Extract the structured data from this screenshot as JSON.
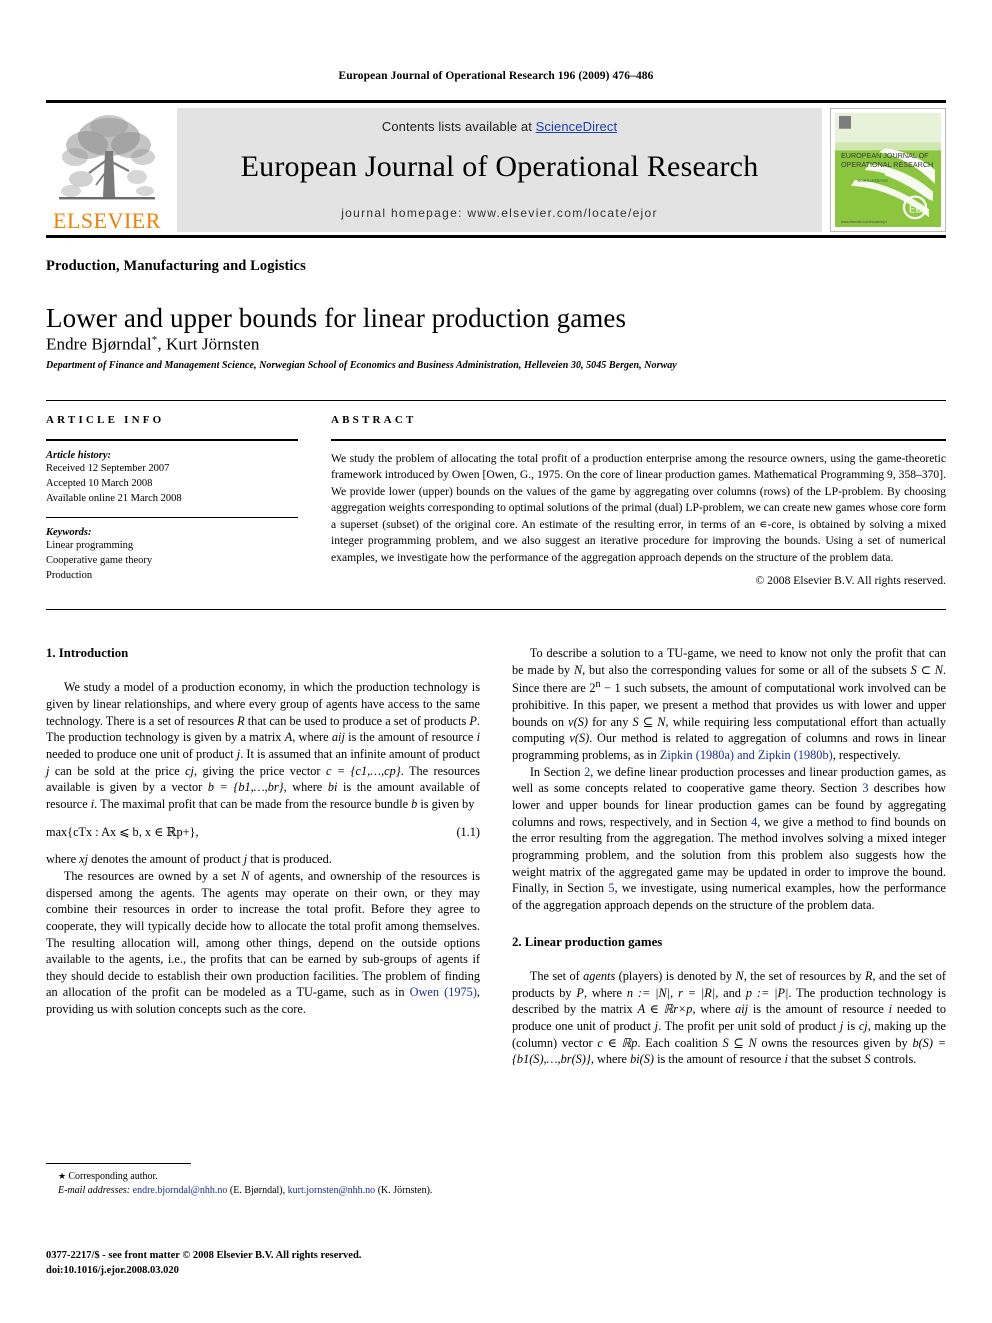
{
  "running_head": "European Journal of Operational Research 196 (2009) 476–486",
  "masthead": {
    "contents_prefix": "Contents lists available at ",
    "contents_link": "ScienceDirect",
    "journal_title": "European Journal of Operational Research",
    "homepage": "journal homepage: www.elsevier.com/locate/ejor",
    "publisher_wordmark": "ELSEVIER",
    "cover_line1": "EUROPEAN JOURNAL OF",
    "cover_line2": "OPERATIONAL RESEARCH",
    "cover_line3": "ScienceDirect",
    "cover_footer": "www.elsevier.com/locate/ejor",
    "colors": {
      "link": "#1a3fae",
      "elsevier_orange": "#f08000",
      "panel_gray": "#e3e3e3",
      "cover_green": "#8cc63f"
    }
  },
  "article": {
    "section_category": "Production, Manufacturing and Logistics",
    "title": "Lower and upper bounds for linear production games",
    "authors": "Endre Bjørndal",
    "corresponding_marker": "*",
    "authors_rest": ", Kurt Jörnsten",
    "affiliation": "Department of Finance and Management Science, Norwegian School of Economics and Business Administration, Helleveien 30, 5045 Bergen, Norway"
  },
  "info": {
    "heading": "ARTICLE INFO",
    "history_label": "Article history:",
    "history": [
      "Received 12 September 2007",
      "Accepted 10 March 2008",
      "Available online 21 March 2008"
    ],
    "keywords_label": "Keywords:",
    "keywords": [
      "Linear programming",
      "Cooperative game theory",
      "Production"
    ]
  },
  "abstract": {
    "heading": "ABSTRACT",
    "text": "We study the problem of allocating the total profit of a production enterprise among the resource owners, using the game-theoretic framework introduced by Owen [Owen, G., 1975. On the core of linear production games. Mathematical Programming 9, 358–370]. We provide lower (upper) bounds on the values of the game by aggregating over columns (rows) of the LP-problem. By choosing aggregation weights corresponding to optimal solutions of the primal (dual) LP-problem, we can create new games whose core form a superset (subset) of the original core. An estimate of the resulting error, in terms of an ∊-core, is obtained by solving a mixed integer programming problem, and we also suggest an iterative procedure for improving the bounds. Using a set of numerical examples, we investigate how the performance of the aggregation approach depends on the structure of the problem data.",
    "copyright": "© 2008 Elsevier B.V. All rights reserved."
  },
  "body": {
    "intro_heading": "1. Introduction",
    "intro_p1_a": "We study a model of a production economy, in which the production technology is given by linear relationships, and where every group of agents have access to the same technology. There is a set of resources ",
    "intro_p1_R": "R",
    "intro_p1_b": " that can be used to produce a set of products ",
    "intro_p1_P": "P",
    "intro_p1_c": ". The production technology is given by a matrix ",
    "intro_p1_A": "A",
    "intro_p1_d": ", where ",
    "intro_p1_aij": "aij",
    "intro_p1_e": " is the amount of resource ",
    "intro_p1_i": "i",
    "intro_p1_f": " needed to produce one unit of product ",
    "intro_p1_j": "j",
    "intro_p1_g": ". It is assumed that an infinite amount of product ",
    "intro_p1_j2": "j",
    "intro_p1_h": " can be sold at the price ",
    "intro_p1_cj": "cj",
    "intro_p1_i2": ", giving the price vector ",
    "intro_p1_cvec": "c = {c1,…,cp}",
    "intro_p1_j3": ". The resources available is given by a vector ",
    "intro_p1_bvec": "b = {b1,…,br}",
    "intro_p1_k": ", where ",
    "intro_p1_bi": "bi",
    "intro_p1_l": " is the amount available of resource ",
    "intro_p1_i3": "i",
    "intro_p1_m": ". The maximal profit that can be made from the resource bundle ",
    "intro_p1_b2": "b",
    "intro_p1_n": " is given by",
    "equation_1_1": "max{cTx : Ax ⩽ b, x ∈ ℝp+},",
    "equation_1_1_number": "(1.1)",
    "intro_p2_a": "where ",
    "intro_p2_xj": "xj",
    "intro_p2_b": " denotes the amount of product ",
    "intro_p2_j": "j",
    "intro_p2_c": " that is produced.",
    "intro_p3_a": "The resources are owned by a set ",
    "intro_p3_N": "N",
    "intro_p3_b": " of agents, and ownership of the resources is dispersed among the agents. The agents may operate on their own, or they may combine their resources in order to increase the total profit. Before they agree to cooperate, they will typically decide how to allocate the total profit among themselves. The resulting allocation will, among other things, depend on the outside options available to the agents, i.e., the profits that can be earned by sub-groups of agents if they should decide to establish their own production facilities. The problem of finding an allocation of the profit can be modeled as a TU-game, such as in ",
    "intro_p3_link": "Owen (1975)",
    "intro_p3_c": ", providing us with solution concepts such as the core.",
    "right_p1_a": "To describe a solution to a TU-game, we need to know not only the profit that can be made by ",
    "right_p1_N": "N",
    "right_p1_b": ", but also the corresponding values for some or all of the subsets ",
    "right_p1_SN": "S ⊂ N",
    "right_p1_c": ". Since there are 2",
    "right_p1_n_sup": "n",
    "right_p1_d": " − 1 such subsets, the amount of computational work involved can be prohibitive. In this paper, we present a method that provides us with lower and upper bounds on ",
    "right_p1_vS": "v(S)",
    "right_p1_e": " for any ",
    "right_p1_SsubN": "S ⊆ N",
    "right_p1_f": ", while requiring less computational effort than actually computing ",
    "right_p1_vS2": "v(S)",
    "right_p1_g": ". Our method is related to aggregation of columns and rows in linear programming problems, as in ",
    "right_p1_link1": "Zipkin (1980a) and Zipkin (1980b)",
    "right_p1_h": ", respectively.",
    "right_p2_a": "In Section ",
    "right_p2_s2": "2",
    "right_p2_b": ", we define linear production processes and linear production games, as well as some concepts related to cooperative game theory. Section ",
    "right_p2_s3": "3",
    "right_p2_c": " describes how lower and upper bounds for linear production games can be found by aggregating columns and rows, respectively, and in Section ",
    "right_p2_s4": "4",
    "right_p2_d": ", we give a method to find bounds on the error resulting from the aggregation. The method involves solving a mixed integer programming problem, and the solution from this problem also suggests how the weight matrix of the aggregated game may be updated in order to improve the bound. Finally, in Section ",
    "right_p2_s5": "5",
    "right_p2_e": ", we investigate, using numerical examples, how the performance of the aggregation approach depends on the structure of the problem data.",
    "section2_heading": "2. Linear production games",
    "right_p3_a": "The set of ",
    "right_p3_agents": "agents",
    "right_p3_b": " (players) is denoted by ",
    "right_p3_N": "N",
    "right_p3_c": ", the set of resources by ",
    "right_p3_R": "R",
    "right_p3_d": ", and the set of products by ",
    "right_p3_P": "P",
    "right_p3_e": ", where ",
    "right_p3_n": "n := |N|",
    "right_p3_f": ", ",
    "right_p3_r": "r = |R|",
    "right_p3_g": ", and ",
    "right_p3_p": "p := |P|",
    "right_p3_h": ". The production technology is described by the matrix ",
    "right_p3_A": "A ∈ ℝr×p",
    "right_p3_i": ", where ",
    "right_p3_aij": "aij",
    "right_p3_j": " is the amount of resource ",
    "right_p3_i2": "i",
    "right_p3_k": " needed to produce one unit of product ",
    "right_p3_j2": "j",
    "right_p3_l": ". The profit per unit sold of product ",
    "right_p3_j3": "j",
    "right_p3_m": " is ",
    "right_p3_cj": "cj",
    "right_p3_n2": ", making up the (column) vector ",
    "right_p3_c_vec": "c ∈ ℝp",
    "right_p3_o": ". Each coalition ",
    "right_p3_SN": "S ⊆ N",
    "right_p3_p2": " owns the resources given by ",
    "right_p3_bS": "b(S) = {b1(S),…,br(S)}",
    "right_p3_q": ", where ",
    "right_p3_biS": "bi(S)",
    "right_p3_r2": " is the amount of resource ",
    "right_p3_i3": "i",
    "right_p3_s": " that the subset ",
    "right_p3_S": "S",
    "right_p3_t": " controls."
  },
  "footnotes": {
    "corresponding": "Corresponding author.",
    "email_label": "E-mail addresses:",
    "email1": "endre.bjorndal@nhh.no",
    "email1_name": " (E. Bjørndal), ",
    "email2": "kurt.jornsten@nhh.no",
    "email2_name": " (K. Jörnsten).",
    "imprint_line1": "0377-2217/$ - see front matter © 2008 Elsevier B.V. All rights reserved.",
    "imprint_line2": "doi:10.1016/j.ejor.2008.03.020"
  }
}
